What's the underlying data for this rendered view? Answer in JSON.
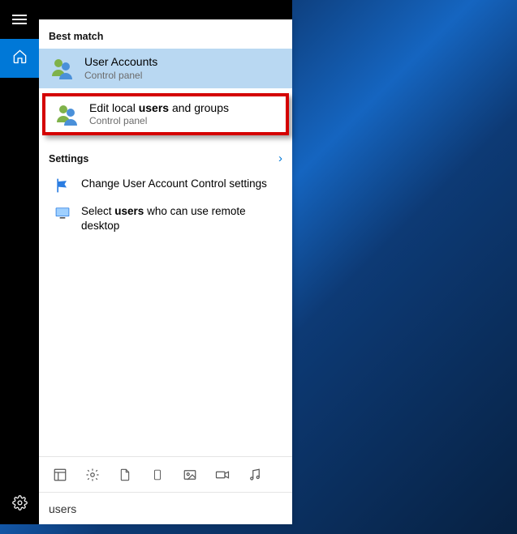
{
  "sections": {
    "best_match": "Best match",
    "settings": "Settings"
  },
  "results": {
    "user_accounts": {
      "title": "User Accounts",
      "subtitle": "Control panel"
    },
    "edit_local": {
      "title_pre": "Edit local ",
      "title_bold": "users",
      "title_post": " and groups",
      "subtitle": "Control panel"
    },
    "uac": {
      "text": "Change User Account Control settings"
    },
    "remote": {
      "text_pre": "Select ",
      "text_bold": "users",
      "text_post": " who can use remote desktop"
    }
  },
  "search": {
    "value": "users"
  }
}
